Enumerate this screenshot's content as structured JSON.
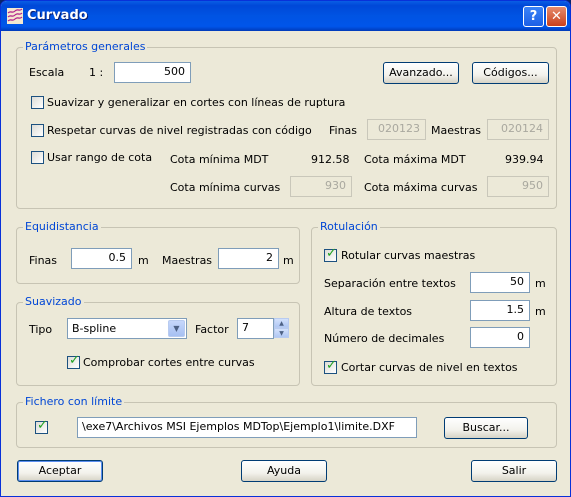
{
  "window": {
    "title": "Curvado",
    "help_btn": "?",
    "close_btn": "✕"
  },
  "generales": {
    "legend": "Parámetros generales",
    "escala_label": "Escala",
    "escala_prefix": "1 :",
    "escala_value": "500",
    "avanzado_btn": "Avanzado...",
    "codigos_btn": "Códigos...",
    "suavizar_label": "Suavizar y generalizar en cortes con líneas de ruptura",
    "suavizar_checked": false,
    "respetar_label": "Respetar curvas de nivel registradas con código",
    "respetar_checked": false,
    "finas_label": "Finas",
    "finas_code": "020123",
    "maestras_label": "Maestras",
    "maestras_code": "020124",
    "rango_label": "Usar rango de cota",
    "rango_checked": false,
    "cota_min_mdt_label": "Cota mínima MDT",
    "cota_min_mdt": "912.58",
    "cota_max_mdt_label": "Cota máxima MDT",
    "cota_max_mdt": "939.94",
    "cota_min_curvas_label": "Cota mínima curvas",
    "cota_min_curvas": "930",
    "cota_max_curvas_label": "Cota máxima curvas",
    "cota_max_curvas": "950"
  },
  "equidistancia": {
    "legend": "Equidistancia",
    "finas_label": "Finas",
    "finas_value": "0.5",
    "finas_unit": "m",
    "maestras_label": "Maestras",
    "maestras_value": "2",
    "maestras_unit": "m"
  },
  "suavizado": {
    "legend": "Suavizado",
    "tipo_label": "Tipo",
    "tipo_value": "B-spline",
    "factor_label": "Factor",
    "factor_value": "7",
    "comprobar_label": "Comprobar cortes entre curvas",
    "comprobar_checked": true
  },
  "rotulacion": {
    "legend": "Rotulación",
    "rotular_label": "Rotular curvas maestras",
    "rotular_checked": true,
    "separacion_label": "Separación entre textos",
    "separacion_value": "50",
    "separacion_unit": "m",
    "altura_label": "Altura de textos",
    "altura_value": "1.5",
    "altura_unit": "m",
    "decimales_label": "Número de decimales",
    "decimales_value": "0",
    "cortar_label": "Cortar curvas de nivel en textos",
    "cortar_checked": true
  },
  "fichero": {
    "legend": "Fichero con límite",
    "checked": true,
    "path": "\\exe7\\Archivos MSI Ejemplos MDTop\\Ejemplo1\\limite.DXF",
    "buscar_btn": "Buscar..."
  },
  "footer": {
    "aceptar_btn": "Aceptar",
    "ayuda_btn": "Ayuda",
    "salir_btn": "Salir"
  }
}
